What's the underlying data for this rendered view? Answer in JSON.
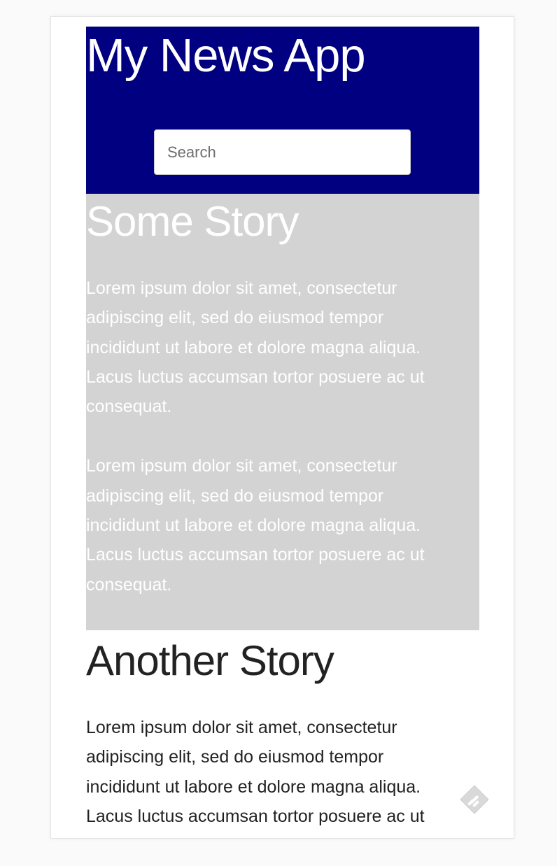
{
  "header": {
    "title": "My News App",
    "background": "#000080"
  },
  "search": {
    "placeholder": "Search",
    "value": ""
  },
  "stories": [
    {
      "title": "Some Story",
      "background": "#d3d3d3",
      "paragraphs": [
        "Lorem ipsum dolor sit amet, consectetur adipiscing elit, sed do eiusmod tempor incididunt ut labore et dolore magna aliqua. Lacus luctus accumsan tortor posuere ac ut consequat.",
        "Lorem ipsum dolor sit amet, consectetur adipiscing elit, sed do eiusmod tempor incididunt ut labore et dolore magna aliqua. Lacus luctus accumsan tortor posuere ac ut consequat."
      ]
    },
    {
      "title": "Another Story",
      "background": "#ffffff",
      "paragraphs": [
        "Lorem ipsum dolor sit amet, consectetur adipiscing elit, sed do eiusmod tempor incididunt ut labore et dolore magna aliqua. Lacus luctus accumsan tortor posuere ac ut consequat."
      ]
    }
  ],
  "floating_icon": {
    "icon": "feedly-icon",
    "color": "#d8d8d8"
  }
}
